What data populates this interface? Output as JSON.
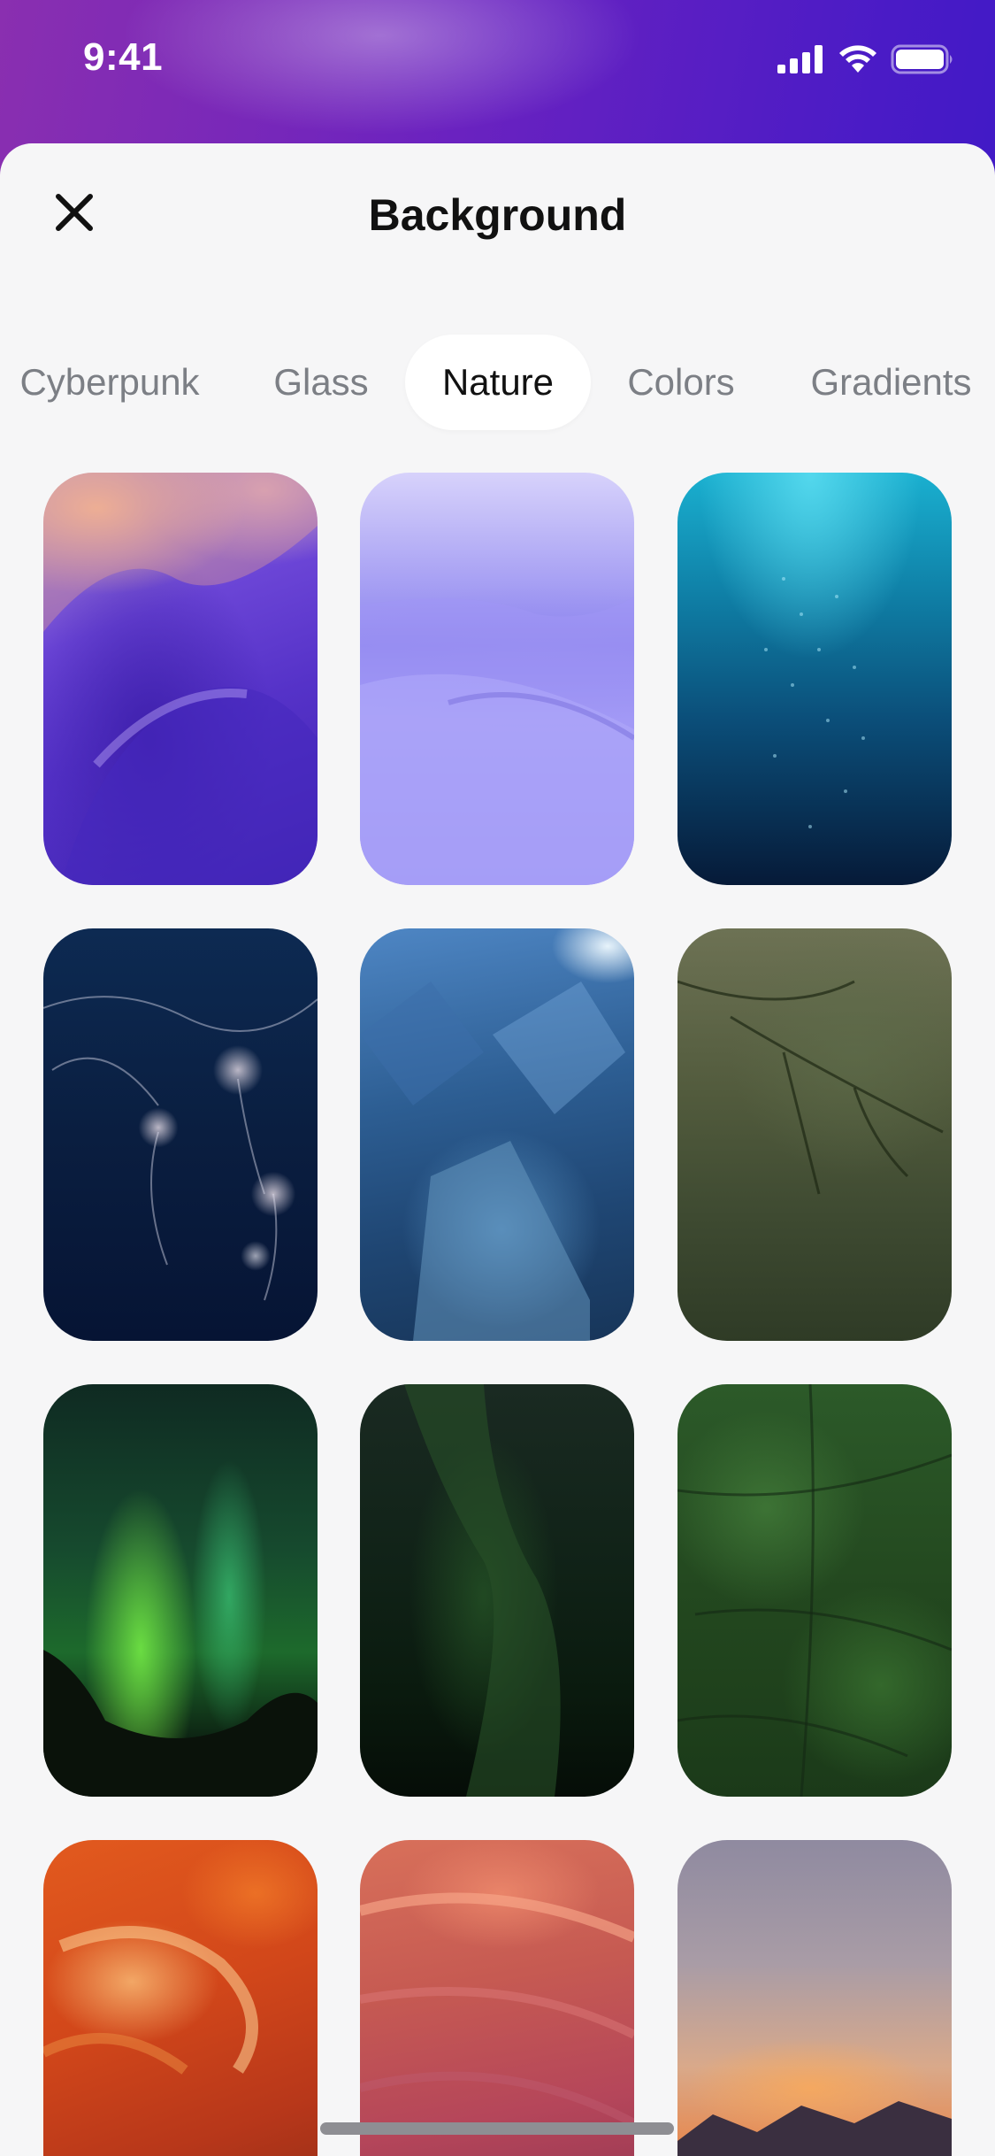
{
  "status_bar": {
    "time": "9:41",
    "icons": [
      "signal-icon",
      "wifi-icon",
      "battery-icon"
    ]
  },
  "sheet": {
    "title": "Background",
    "close_icon": "close-icon"
  },
  "tabs": [
    {
      "label": "Cyberpunk",
      "active": false
    },
    {
      "label": "Glass",
      "active": false
    },
    {
      "label": "Nature",
      "active": true
    },
    {
      "label": "Colors",
      "active": false
    },
    {
      "label": "Gradients",
      "active": false
    }
  ],
  "wallpapers": [
    {
      "name": "purple-canyon"
    },
    {
      "name": "purple-dunes"
    },
    {
      "name": "underwater-bubbles"
    },
    {
      "name": "jellyfish"
    },
    {
      "name": "ice-cave"
    },
    {
      "name": "pine-branches"
    },
    {
      "name": "green-aurora"
    },
    {
      "name": "forest-tree"
    },
    {
      "name": "fern-leaves"
    },
    {
      "name": "orange-canyon"
    },
    {
      "name": "pink-canyon"
    },
    {
      "name": "mountain-sunset"
    }
  ],
  "colors": {
    "sheet_background": "#f6f6f7",
    "active_tab_background": "#ffffff",
    "inactive_tab_text": "#7c7f85",
    "active_tab_text": "#111111"
  }
}
